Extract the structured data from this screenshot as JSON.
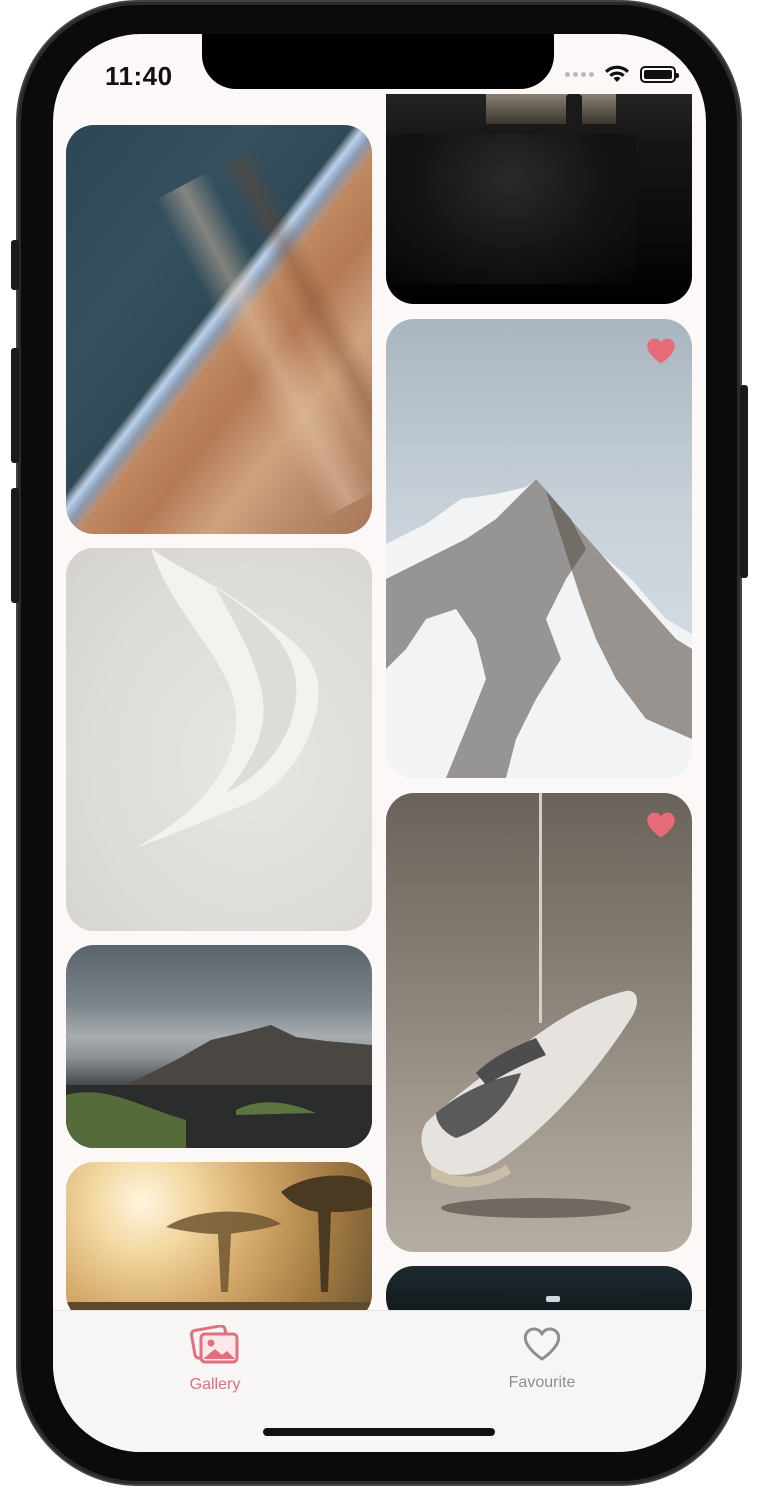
{
  "status_bar": {
    "time": "11:40"
  },
  "gallery": {
    "tiles": [
      {
        "subject": "aerial coastline",
        "favourite": false
      },
      {
        "subject": "dark corridor with people",
        "favourite": false
      },
      {
        "subject": "white fabric sculpture",
        "favourite": false
      },
      {
        "subject": "snowy mountain peak",
        "favourite": true
      },
      {
        "subject": "mountain landscape with clouds",
        "favourite": false
      },
      {
        "subject": "hanging sneaker",
        "favourite": true
      },
      {
        "subject": "misty savanna sunset",
        "favourite": false
      },
      {
        "subject": "dark night scene",
        "favourite": false
      }
    ]
  },
  "tab_bar": {
    "tabs": [
      {
        "label": "Gallery",
        "icon": "photos-icon",
        "active": true
      },
      {
        "label": "Favourite",
        "icon": "heart-outline-icon",
        "active": false
      }
    ],
    "active_color": "#e0707e",
    "inactive_color": "#8e8e8e"
  },
  "colors": {
    "favourite_heart": "#e86b7a"
  }
}
